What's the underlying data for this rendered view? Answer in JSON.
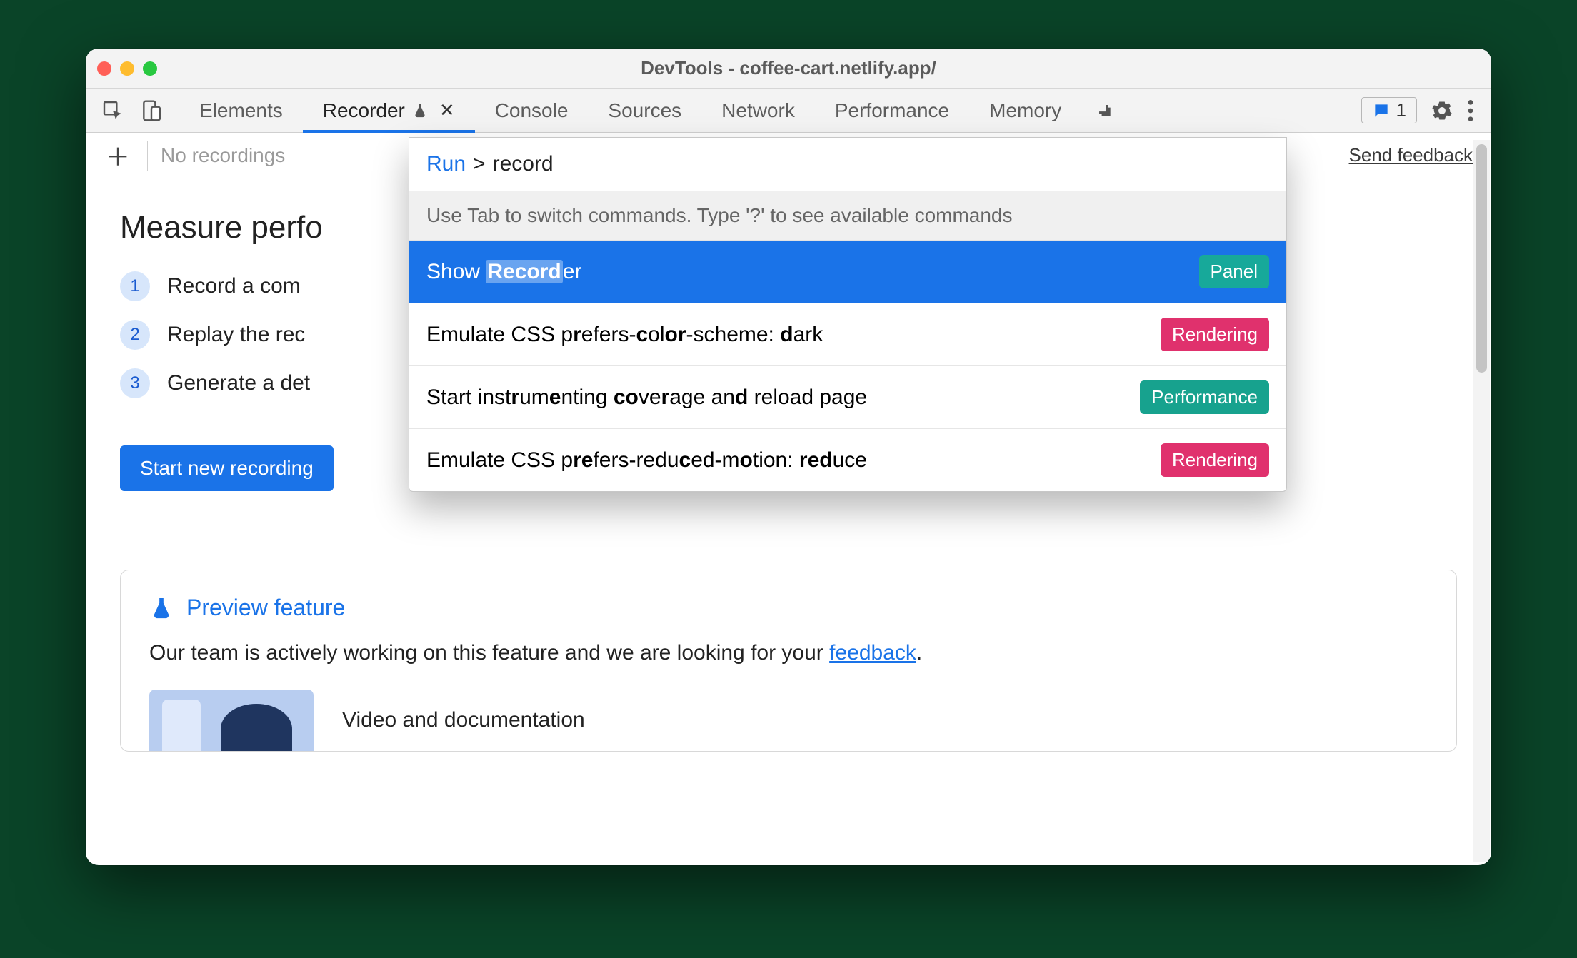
{
  "window": {
    "title": "DevTools - coffee-cart.netlify.app/"
  },
  "tabs": {
    "items": [
      {
        "label": "Elements"
      },
      {
        "label": "Recorder"
      },
      {
        "label": "Console"
      },
      {
        "label": "Sources"
      },
      {
        "label": "Network"
      },
      {
        "label": "Performance"
      },
      {
        "label": "Memory"
      }
    ],
    "messages_count": "1"
  },
  "toolbar": {
    "no_recordings": "No recordings",
    "send_feedback": "Send feedback"
  },
  "page": {
    "heading": "Measure perfo",
    "steps": [
      {
        "n": "1",
        "text": "Record a com"
      },
      {
        "n": "2",
        "text": "Replay the rec"
      },
      {
        "n": "3",
        "text": "Generate a det"
      }
    ],
    "start_button": "Start new recording"
  },
  "preview": {
    "title": "Preview feature",
    "body_a": "Our team is actively working on this feature and we are looking for your ",
    "body_link": "feedback",
    "body_b": ".",
    "media_title": "Video and documentation"
  },
  "palette": {
    "prefix": "Run",
    "caret": ">",
    "query": "record",
    "hint": "Use Tab to switch commands. Type '?' to see available commands",
    "items": [
      {
        "html": "Show <span class='hl'><b>Record</b></span>er",
        "badge": "Panel",
        "badge_cls": "panel",
        "selected": true
      },
      {
        "html": "Emulate CSS p<b>r</b>efers-<b>c</b>ol<b>or</b>-scheme: <b>d</b>ark",
        "badge": "Rendering",
        "badge_cls": "rendering"
      },
      {
        "html": "Start inst<b>r</b>um<b>e</b>nting <b>co</b>ve<b>r</b>age an<b>d</b> reload page",
        "badge": "Performance",
        "badge_cls": "perf"
      },
      {
        "html": "Emulate CSS p<b>re</b>fers-redu<b>c</b>ed-m<b>o</b>tion: <b>red</b>uce",
        "badge": "Rendering",
        "badge_cls": "rendering"
      }
    ]
  }
}
